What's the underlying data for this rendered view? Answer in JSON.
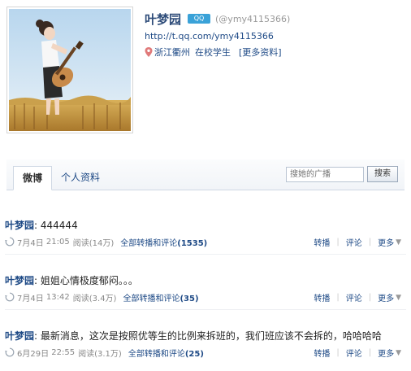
{
  "profile": {
    "name": "叶梦园",
    "badge": "QQ",
    "handle": "(@ymy4115366)",
    "url": "http://t.qq.com/ymy4115366",
    "location": "浙江衢州",
    "occupation": "在校学生",
    "more_link": "[更多资料]"
  },
  "tabs": {
    "weibo": "微博",
    "personal": "个人资料"
  },
  "search": {
    "placeholder": "搜她的广播",
    "button": "搜索"
  },
  "posts": [
    {
      "author": "叶梦园",
      "colon": ":",
      "text": "444444",
      "date": "7月4日",
      "time": "21:05",
      "reads": "阅读(14万)",
      "all_label": "全部转播和评论",
      "count": "(1535)"
    },
    {
      "author": "叶梦园",
      "colon": ":",
      "text": "姐姐心情极度郁闷。。。",
      "date": "7月4日",
      "time": "13:42",
      "reads": "阅读(3.4万)",
      "all_label": "全部转播和评论",
      "count": "(35)"
    },
    {
      "author": "叶梦园",
      "colon": ":",
      "text": "最新消息，这次是按照优等生的比例来拆班的，我们班应该不会拆的，哈哈哈哈",
      "date": "6月29日",
      "time": "22:55",
      "reads": "阅读(3.1万)",
      "all_label": "全部转播和评论",
      "count": "(25)"
    }
  ],
  "actions": {
    "repost": "转播",
    "comment": "评论",
    "more": "更多",
    "sep": "|"
  },
  "colors": {
    "link": "#1e4a86",
    "badge": "#3aa2d8"
  }
}
